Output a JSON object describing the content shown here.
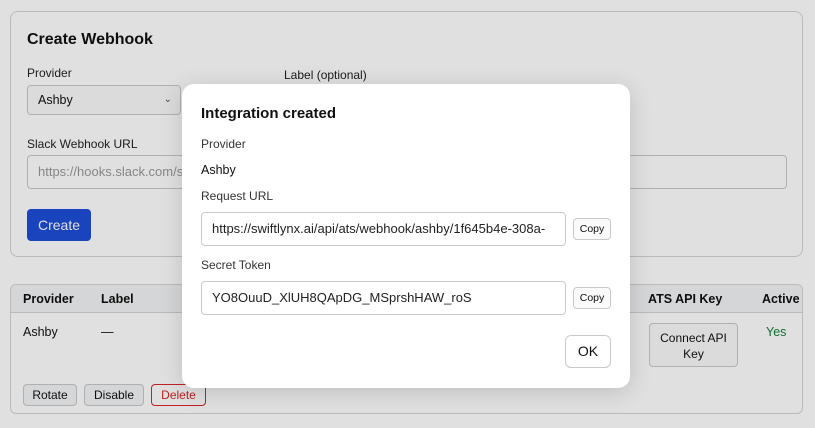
{
  "create_webhook": {
    "title": "Create Webhook",
    "provider_label": "Provider",
    "provider_value": "Ashby",
    "label_optional_label": "Label (optional)",
    "slack_url_label": "Slack Webhook URL",
    "slack_url_placeholder": "https://hooks.slack.com/s",
    "create_label": "Create"
  },
  "table": {
    "headers": [
      "Provider",
      "Label",
      "ATS API Key",
      "Active"
    ],
    "rows": [
      {
        "provider": "Ashby",
        "label": "—",
        "ats_api_key_button": "Connect API Key",
        "active": "Yes",
        "actions": [
          "Rotate",
          "Disable",
          "Delete"
        ]
      }
    ]
  },
  "modal": {
    "title": "Integration created",
    "provider_label": "Provider",
    "provider_value": "Ashby",
    "request_url_label": "Request URL",
    "request_url_value": "https://swiftlynx.ai/api/ats/webhook/ashby/1f645b4e-308a-",
    "secret_token_label": "Secret Token",
    "secret_token_value": "YO8OuuD_XlUH8QApDG_MSprshHAW_roS",
    "copy_label": "Copy",
    "ok_label": "OK"
  },
  "colors": {
    "primary": "#1d4ed8",
    "danger": "#dc2626",
    "success": "#15803d"
  }
}
